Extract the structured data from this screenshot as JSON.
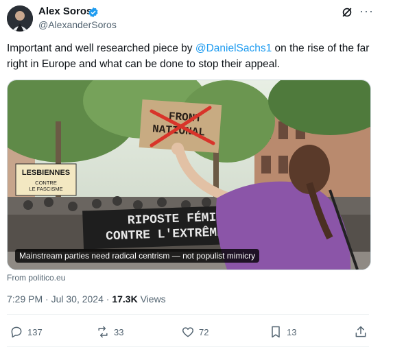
{
  "author": {
    "name": "Alex Soros",
    "handle": "@AlexanderSoros"
  },
  "tweet": {
    "text_before": "Important and well researched piece by ",
    "mention": "@DanielSachs1",
    "text_after": " on the rise of the far right in Europe and what can be done to stop their appeal."
  },
  "card": {
    "caption": "Mainstream parties need radical centrism — not populist mimicry",
    "source": "From politico.eu",
    "photo_signs": {
      "front_national": "FRONT\nNATIONAL",
      "lesbiennes": "LESBIENNES",
      "contre_fascisme": "CONTRE\nLE FASCISME",
      "banner": "RIPOSTE FÉMI\nCONTRE L'EXTRÊME-D"
    }
  },
  "meta": {
    "time": "7:29 PM",
    "date": "Jul 30, 2024",
    "views_count": "17.3K",
    "views_label": "Views"
  },
  "actions": {
    "replies": "137",
    "reposts": "33",
    "likes": "72",
    "bookmarks": "13"
  },
  "colors": {
    "accent": "#1d9bf0",
    "text": "#0f1419",
    "secondary": "#536471",
    "sweater": "#8b55a8"
  },
  "icons": [
    "verified-badge-icon",
    "grok-icon",
    "more-icon",
    "reply-icon",
    "repost-icon",
    "like-icon",
    "bookmark-icon",
    "share-icon"
  ]
}
